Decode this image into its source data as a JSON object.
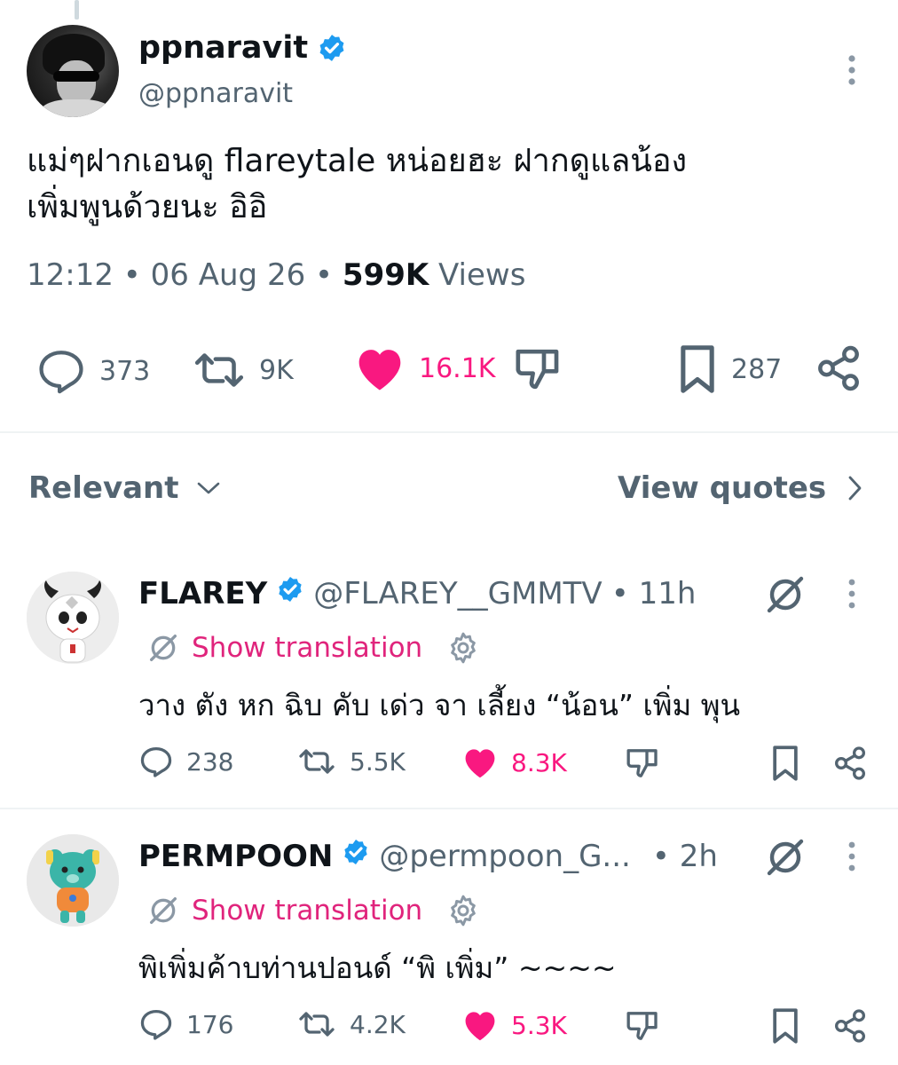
{
  "main_tweet": {
    "display_name": "ppnaravit",
    "handle": "@ppnaravit",
    "text_line1": "แม่ๆฝากเอนดู flareytale หน่อยฮะ ฝากดูแลน้อง",
    "text_line2": "เพิ่มพูนด้วยนะ อิอิ",
    "time": "12:12",
    "date": "06 Aug 26",
    "views_count": "599K",
    "views_label": "Views",
    "replies": "373",
    "reposts": "9K",
    "likes": "16.1K",
    "bookmarks": "287"
  },
  "sort": {
    "label": "Relevant",
    "view_quotes": "View quotes"
  },
  "replies": [
    {
      "display_name": "FLAREY",
      "handle": "@FLAREY__GMMTV",
      "time": "• 11h",
      "translate_label": "Show translation",
      "text": "วาง ตัง หก ฉิบ คับ เด่ว จา เลี้ยง “น้อน” เพิ่ม พุน",
      "replies": "238",
      "reposts": "5.5K",
      "likes": "8.3K"
    },
    {
      "display_name": "PERMPOON",
      "handle": "@permpoon_G...",
      "time": "• 2h",
      "translate_label": "Show translation",
      "text": "พิเพิ่มค้าบท่านปอนด์ “พิ เพิ่ม” ~~~~",
      "replies": "176",
      "reposts": "4.2K",
      "likes": "5.3K"
    }
  ],
  "colors": {
    "accent_pink": "#f91880",
    "translate_pink": "#e0247c",
    "verified_blue": "#1d9bf0",
    "secondary_text": "#536471"
  }
}
